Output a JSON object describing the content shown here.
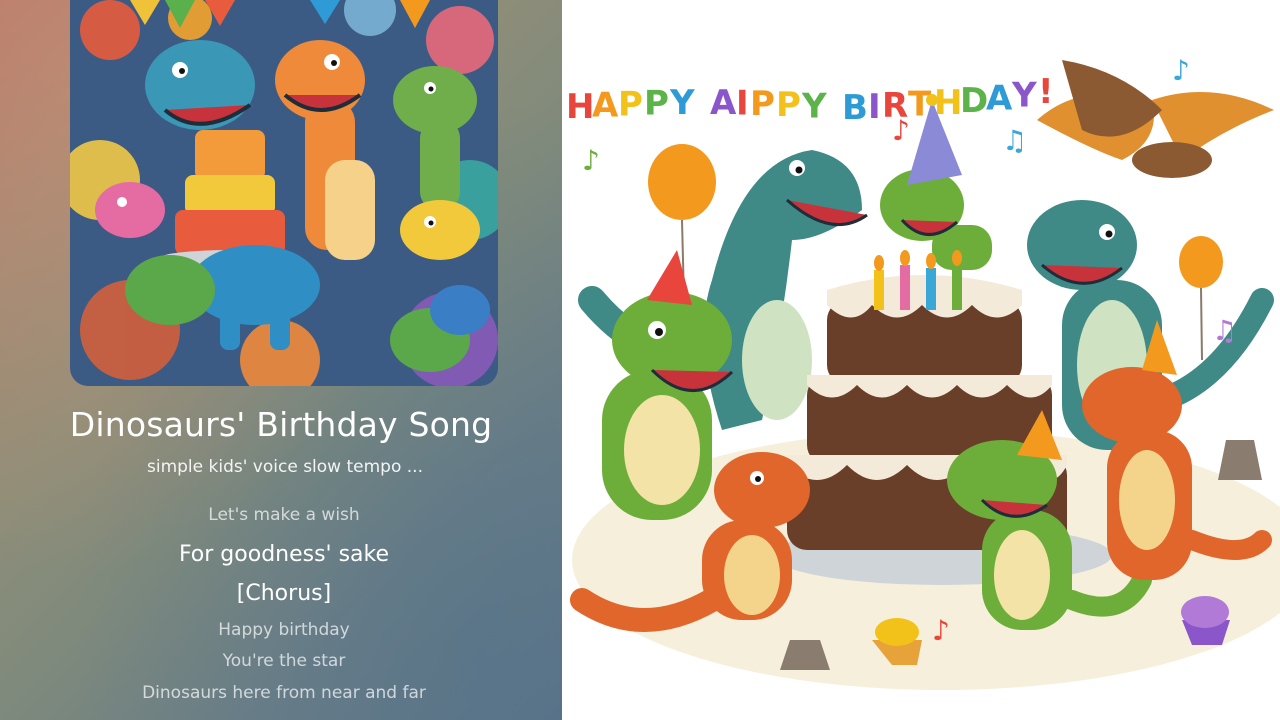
{
  "song": {
    "title": "Dinosaurs' Birthday Song",
    "subtitle": "simple kids' voice slow tempo ..."
  },
  "lyrics": [
    {
      "text": "Let's make a wish",
      "state": "past"
    },
    {
      "text": "For goodness' sake",
      "state": "current"
    },
    {
      "text": "[Chorus]",
      "state": "current"
    },
    {
      "text": "Happy birthday",
      "state": "upcoming"
    },
    {
      "text": "You're the star",
      "state": "upcoming"
    },
    {
      "text": "Dinosaurs here from near and far",
      "state": "upcoming"
    }
  ],
  "artwork": {
    "banner_text": "HAPPY AIPPY BIRTHDAY!",
    "banner_colors": [
      "#e8453c",
      "#f39a1e",
      "#f2c21b",
      "#5bb34a",
      "#2f9bd6",
      "#8b56c9"
    ]
  },
  "colors": {
    "dino_green": "#6dae3a",
    "dino_teal": "#3f8a86",
    "dino_orange": "#e0662b",
    "cake_brown": "#6a3f2a",
    "icing": "#f3ead9"
  }
}
